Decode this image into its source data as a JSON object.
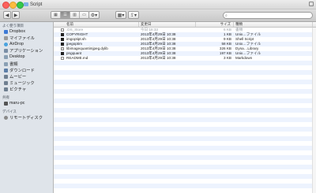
{
  "window": {
    "title": "Script"
  },
  "toolbar": {
    "back": "◀",
    "forward": "▶",
    "search_placeholder": ""
  },
  "sidebar": {
    "favorites_header": "よく使う項目",
    "favorites": [
      {
        "label": "Dropbox",
        "icon": "dropbox-icon",
        "color": "#3d7ad6"
      },
      {
        "label": "マイファイル",
        "icon": "all-files-icon",
        "color": "#9a9a9a"
      },
      {
        "label": "AirDrop",
        "icon": "airdrop-icon",
        "color": "#4aa3df"
      },
      {
        "label": "アプリケーション",
        "icon": "applications-icon",
        "color": "#7a8ea6"
      },
      {
        "label": "Desktop",
        "icon": "desktop-icon",
        "color": "#8aa0b4"
      },
      {
        "label": "書類",
        "icon": "documents-icon",
        "color": "#8aa0b4"
      },
      {
        "label": "ダウンロード",
        "icon": "downloads-icon",
        "color": "#5d7fa8"
      },
      {
        "label": "ムービー",
        "icon": "movies-icon",
        "color": "#6f7f90"
      },
      {
        "label": "ミュージック",
        "icon": "music-icon",
        "color": "#6f7f90"
      },
      {
        "label": "ピクチャ",
        "icon": "pictures-icon",
        "color": "#6f7f90"
      }
    ],
    "shared_header": "共有",
    "shared": [
      {
        "label": "maru-pc",
        "icon": "computer-icon",
        "color": "#555"
      }
    ],
    "devices_header": "デバイス",
    "devices": [
      {
        "label": "リモートディスク",
        "icon": "disc-icon",
        "color": "#8a8a8a"
      }
    ]
  },
  "columns": {
    "name": "名前",
    "modified": "変更日",
    "size": "サイズ",
    "kind": "種類"
  },
  "files": [
    {
      "name": ".DS_Store",
      "modified": "今日 18:33",
      "size": "6 KB",
      "kind": "書類",
      "dim": true,
      "type": "doc"
    },
    {
      "name": "COPYRIGHT",
      "modified": "2013年4月29日 10:38",
      "size": "1 KB",
      "kind": "Unix…ファイル",
      "dim": false,
      "type": "exec"
    },
    {
      "name": "imgoptipt.sh",
      "modified": "2013年4月29日 10:38",
      "size": "9 KB",
      "kind": "Shell Script",
      "dim": false,
      "type": "exec"
    },
    {
      "name": "jpegoptim",
      "modified": "2013年4月29日 10:38",
      "size": "58 KB",
      "kind": "Unix…ファイル",
      "dim": false,
      "type": "exec"
    },
    {
      "name": "libimagequantimjpeg.dylib",
      "modified": "2013年4月29日 10:38",
      "size": "326 KB",
      "kind": "Dyna…Library",
      "dim": false,
      "type": "lib"
    },
    {
      "name": "pngquant",
      "modified": "2013年4月29日 10:38",
      "size": "197 KB",
      "kind": "Unix…ファイル",
      "dim": false,
      "type": "exec"
    },
    {
      "name": "README.md",
      "modified": "2013年4月29日 10:38",
      "size": "3 KB",
      "kind": "Markdown",
      "dim": false,
      "type": "doc"
    }
  ]
}
